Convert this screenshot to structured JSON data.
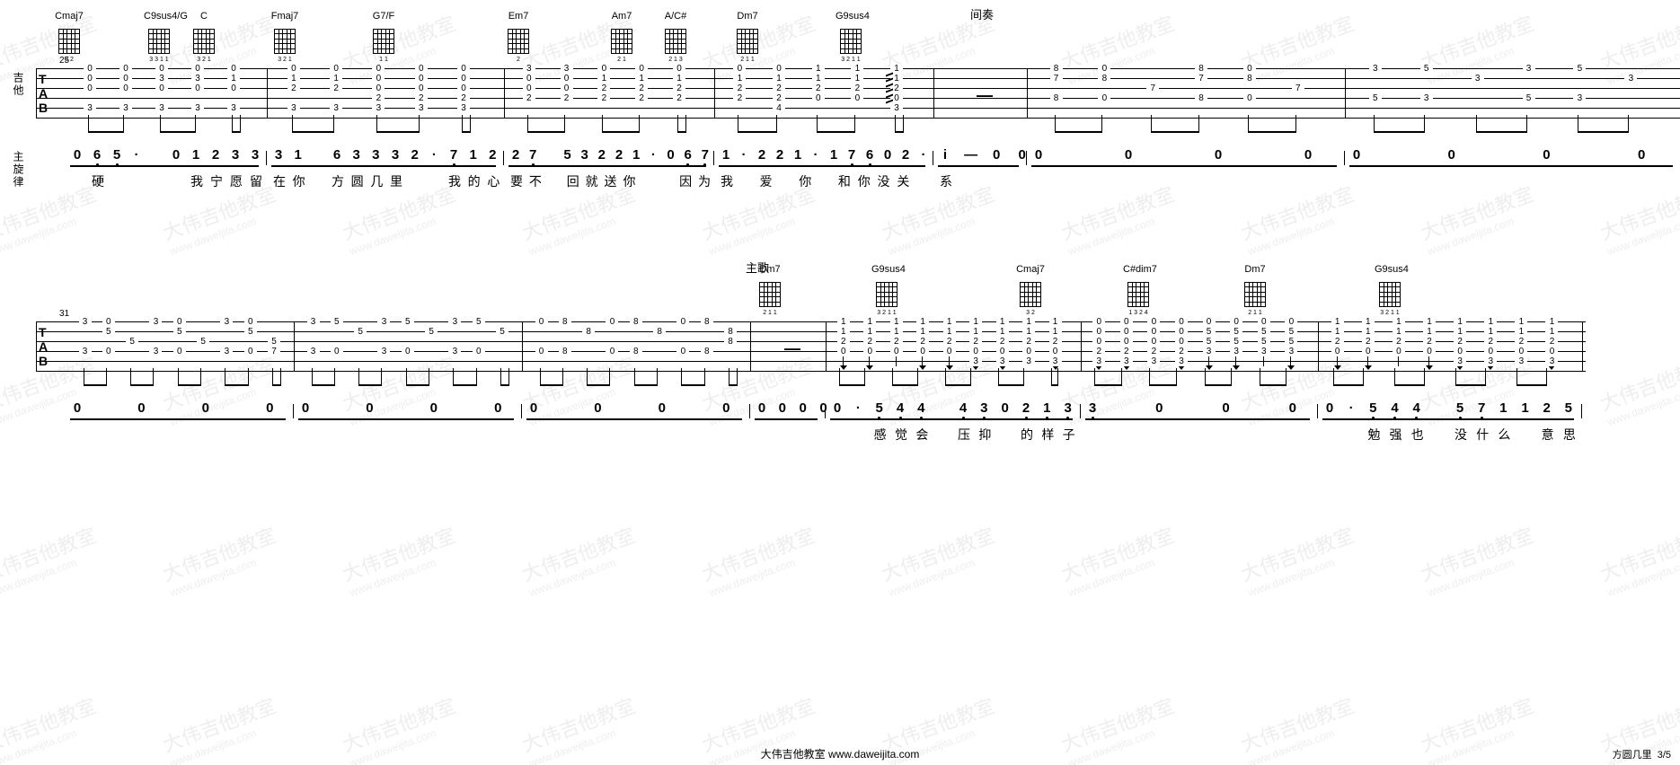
{
  "page": {
    "footer_text": "大伟吉他教室  www.daweijita.com",
    "song_title": "方圆几里",
    "page_indicator": "3/5",
    "watermark_line1": "大伟吉他教室",
    "watermark_line2": "www.daweijita.com"
  },
  "labels": {
    "guitar": "吉他",
    "melody": "主旋律",
    "tab_clef_T": "T",
    "tab_clef_A": "A",
    "tab_clef_B": "B",
    "interlude": "间奏",
    "verse": "主歌"
  },
  "system1": {
    "start_measure": "25",
    "chords": [
      {
        "name": "Cmaj7",
        "fingering": "3 2"
      },
      {
        "name": "C9sus4/G",
        "fingering": "3 3 1 1"
      },
      {
        "name": "C",
        "fingering": "3 2   1"
      },
      {
        "name": "Fmaj7",
        "fingering": "3 2 1"
      },
      {
        "name": "G7/F",
        "fingering": "1     1"
      },
      {
        "name": "Em7",
        "fingering": "2"
      },
      {
        "name": "Am7",
        "fingering": "2   1"
      },
      {
        "name": "A/C#",
        "fingering": "2 1 3"
      },
      {
        "name": "Dm7",
        "fingering": "2 1 1"
      },
      {
        "name": "G9sus4",
        "fingering": "3   2 1 1"
      }
    ],
    "measures": [
      {
        "tab": [
          [
            "0",
            "0",
            "0",
            "",
            "3"
          ],
          [
            "0",
            "0",
            "0",
            "",
            "3"
          ],
          [
            "0",
            "3",
            "0",
            "",
            "3"
          ],
          [
            "0",
            "3",
            "0",
            "",
            "3"
          ],
          [
            "0",
            "1",
            "0",
            "",
            "3"
          ]
        ],
        "melody": [
          "0",
          "6̣",
          "5̣",
          "·",
          "",
          "0",
          "1",
          "2",
          "3",
          "3"
        ],
        "lyrics": [
          "",
          "硬",
          "",
          "",
          "",
          "",
          "我",
          "宁",
          "愿",
          "留"
        ]
      },
      {
        "tab": [
          [
            "0",
            "1",
            "2",
            "",
            "3"
          ],
          [
            "0",
            "1",
            "2",
            "",
            "3"
          ],
          [
            "0",
            "0",
            "0",
            "2",
            "3"
          ],
          [
            "0",
            "0",
            "0",
            "2",
            "3"
          ],
          [
            "0",
            "0",
            "0",
            "2",
            "3"
          ]
        ],
        "melody": [
          "3",
          "1",
          "",
          "6",
          "3",
          "3",
          "3",
          "2",
          "·",
          "7̣",
          "1",
          "2"
        ],
        "lyrics": [
          "在",
          "你",
          "",
          "方",
          "圆",
          "几",
          "里",
          "",
          "",
          "我",
          "的",
          "心"
        ]
      },
      {
        "tab": [
          [
            "3",
            "0",
            "0",
            "2"
          ],
          [
            "3",
            "0",
            "0",
            "2"
          ],
          [
            "0",
            "1",
            "2",
            "2"
          ],
          [
            "0",
            "1",
            "2",
            "2"
          ],
          [
            "0",
            "1",
            "2",
            "2"
          ]
        ],
        "melody": [
          "2",
          "7̣",
          "",
          "5",
          "3",
          "2",
          "2",
          "1",
          "·",
          "0",
          "6̣",
          "7̣"
        ],
        "lyrics": [
          "要",
          "不",
          "",
          "回",
          "就",
          "送",
          "你",
          "",
          "",
          "因",
          "为"
        ]
      },
      {
        "tab": [
          [
            "0",
            "1",
            "2",
            "2"
          ],
          [
            "0",
            "1",
            "2",
            "2",
            "4"
          ],
          [
            "1",
            "1",
            "2",
            "0"
          ],
          [
            "1",
            "1",
            "2",
            "0"
          ],
          [
            "1",
            "1",
            "2",
            "0",
            "3"
          ]
        ],
        "melody": [
          "1",
          "·",
          "2",
          "2",
          "1",
          "·",
          "1",
          "7̣",
          "6̣",
          "0",
          "2",
          "·"
        ],
        "lyrics": [
          "我",
          "",
          "爱",
          "",
          "你",
          "",
          "和",
          "你",
          "没",
          "关",
          ""
        ]
      },
      {
        "tab": [
          [
            "—"
          ]
        ],
        "melody": [
          "i",
          "",
          "—",
          "",
          "0",
          "",
          "0"
        ],
        "lyrics": [
          "系",
          "",
          "",
          "",
          "",
          ""
        ]
      },
      {
        "tab": [
          [
            "8",
            "7",
            "",
            "8"
          ],
          [
            "0",
            "8",
            "",
            "0"
          ],
          [
            "",
            "",
            "7",
            ""
          ],
          [
            "8",
            "7",
            "",
            "8"
          ],
          [
            "0",
            "8",
            "",
            "0"
          ],
          [
            "",
            "",
            "7",
            ""
          ]
        ],
        "melody": [
          "0",
          "",
          "0",
          "",
          "0",
          "",
          "0"
        ],
        "lyrics": []
      },
      {
        "tab": [
          [
            "3",
            "",
            "",
            "5"
          ],
          [
            "5",
            "",
            "",
            "3"
          ],
          [
            "",
            "3",
            ""
          ],
          [
            "3",
            "",
            "",
            "5"
          ],
          [
            "5",
            "",
            "",
            "3"
          ],
          [
            "",
            "3",
            ""
          ]
        ],
        "melody": [
          "0",
          "",
          "0",
          "",
          "0",
          "",
          "0"
        ],
        "lyrics": []
      }
    ]
  },
  "system2": {
    "start_measure": "31",
    "chords": [
      {
        "name": "Dm7",
        "fingering": "2 1 1"
      },
      {
        "name": "G9sus4",
        "fingering": "3   2 1 1"
      },
      {
        "name": "Cmaj7",
        "fingering": "3 2"
      },
      {
        "name": "C#dim7",
        "fingering": "1 3 2 4"
      },
      {
        "name": "Dm7",
        "fingering": "2 1 1"
      },
      {
        "name": "G9sus4",
        "fingering": "3   2 1 1"
      }
    ],
    "measures": [
      {
        "tab": [
          [
            "3",
            "",
            "",
            "3"
          ],
          [
            "0",
            "5",
            "",
            "0"
          ],
          [
            "",
            "",
            "5",
            ""
          ],
          [
            "3",
            "",
            "",
            "3"
          ],
          [
            "0",
            "5",
            "",
            "0"
          ],
          [
            "",
            "",
            "5",
            ""
          ],
          [
            "3",
            "",
            "",
            "3"
          ],
          [
            "0",
            "5",
            "",
            "0"
          ],
          [
            "",
            "",
            "5",
            "7"
          ]
        ],
        "melody": [
          "0",
          "",
          "0",
          "",
          "0",
          "",
          "0"
        ],
        "lyrics": []
      },
      {
        "tab": [
          [
            "3",
            "",
            "",
            "3"
          ],
          [
            "5",
            "",
            "",
            "0"
          ],
          [
            "",
            "5",
            ""
          ],
          [
            "3",
            "",
            "",
            "3"
          ],
          [
            "5",
            "",
            "",
            "0"
          ],
          [
            "",
            "5",
            ""
          ],
          [
            "3",
            "",
            "",
            "3"
          ],
          [
            "5",
            "",
            "",
            "0"
          ],
          [
            "",
            "5",
            ""
          ]
        ],
        "melody": [
          "0",
          "",
          "0",
          "",
          "0",
          "",
          "0"
        ],
        "lyrics": []
      },
      {
        "tab": [
          [
            "0",
            "",
            "",
            "0"
          ],
          [
            "8",
            "",
            "",
            "8"
          ],
          [
            "",
            "8",
            ""
          ],
          [
            "0",
            "",
            "",
            "0"
          ],
          [
            "8",
            "",
            "",
            "8"
          ],
          [
            "",
            "8",
            ""
          ],
          [
            "0",
            "",
            "",
            "0"
          ],
          [
            "8",
            "",
            "",
            "8"
          ],
          [
            "",
            "8",
            "8"
          ]
        ],
        "melody": [
          "0",
          "",
          "0",
          "",
          "0",
          "",
          "0"
        ],
        "lyrics": []
      },
      {
        "tab": [
          [
            "—"
          ]
        ],
        "melody": [
          "0",
          "",
          "0",
          "",
          "0",
          "",
          "0"
        ],
        "lyrics": []
      },
      {
        "tab_strum": true,
        "cols": [
          {
            "dir": "down",
            "frets": [
              "1",
              "1",
              "2",
              "0"
            ]
          },
          {
            "dir": "down",
            "frets": [
              "1",
              "1",
              "2",
              "0"
            ]
          },
          {
            "dir": "up",
            "frets": [
              "1",
              "1",
              "2",
              "0"
            ]
          },
          {
            "dir": "down",
            "frets": [
              "1",
              "1",
              "2",
              "0"
            ]
          },
          {
            "dir": "down",
            "frets": [
              "1",
              "1",
              "2",
              "0"
            ]
          },
          {
            "dir": "down",
            "frets": [
              "1",
              "1",
              "2",
              "0",
              "3"
            ]
          },
          {
            "dir": "down",
            "frets": [
              "1",
              "1",
              "2",
              "0",
              "3"
            ]
          },
          {
            "dir": "up",
            "frets": [
              "1",
              "1",
              "2",
              "0",
              "3"
            ]
          },
          {
            "dir": "down",
            "frets": [
              "1",
              "1",
              "2",
              "0",
              "3"
            ]
          }
        ],
        "melody": [
          "0",
          "·",
          "5̣",
          "4̣",
          "4̣",
          "",
          "4̣",
          "3̣",
          "0",
          "2̣",
          "1̣",
          "3̣"
        ],
        "lyrics": [
          "",
          "",
          "感",
          "觉",
          "会",
          "",
          "压",
          "抑",
          "",
          "的",
          "样",
          "子"
        ]
      },
      {
        "tab_strum": true,
        "cols": [
          {
            "dir": "down",
            "frets": [
              "0",
              "0",
              "0",
              "2",
              "3"
            ]
          },
          {
            "dir": "down",
            "frets": [
              "0",
              "0",
              "0",
              "2",
              "3"
            ]
          },
          {
            "dir": "up",
            "frets": [
              "0",
              "0",
              "0",
              "2",
              "3"
            ]
          },
          {
            "dir": "down",
            "frets": [
              "0",
              "0",
              "0",
              "2",
              "3"
            ]
          },
          {
            "dir": "down",
            "frets": [
              "0",
              "5",
              "5",
              "3"
            ]
          },
          {
            "dir": "down",
            "frets": [
              "0",
              "5",
              "5",
              "3"
            ]
          },
          {
            "dir": "up",
            "frets": [
              "0",
              "5",
              "5",
              "3"
            ]
          },
          {
            "dir": "down",
            "frets": [
              "0",
              "5",
              "5",
              "3"
            ]
          }
        ],
        "melody": [
          "3̣",
          "",
          "0",
          "",
          "0",
          "",
          "0"
        ],
        "lyrics": []
      },
      {
        "tab_strum": true,
        "cols": [
          {
            "dir": "down",
            "frets": [
              "1",
              "1",
              "2",
              "0"
            ]
          },
          {
            "dir": "down",
            "frets": [
              "1",
              "1",
              "2",
              "0"
            ]
          },
          {
            "dir": "up",
            "frets": [
              "1",
              "1",
              "2",
              "0"
            ]
          },
          {
            "dir": "down",
            "frets": [
              "1",
              "1",
              "2",
              "0"
            ]
          },
          {
            "dir": "down",
            "frets": [
              "1",
              "1",
              "2",
              "0",
              "3"
            ]
          },
          {
            "dir": "down",
            "frets": [
              "1",
              "1",
              "2",
              "0",
              "3"
            ]
          },
          {
            "dir": "up",
            "frets": [
              "1",
              "1",
              "2",
              "0",
              "3"
            ]
          },
          {
            "dir": "down",
            "frets": [
              "1",
              "1",
              "2",
              "0",
              "3"
            ]
          }
        ],
        "melody": [
          "0",
          "·",
          "5̣",
          "4̣",
          "4̣",
          "",
          "5̣",
          "7̣",
          "1",
          "1",
          "2",
          "5"
        ],
        "lyrics": [
          "",
          "",
          "勉",
          "强",
          "也",
          "",
          "没",
          "什",
          "么",
          "",
          "意",
          "思"
        ]
      }
    ]
  }
}
